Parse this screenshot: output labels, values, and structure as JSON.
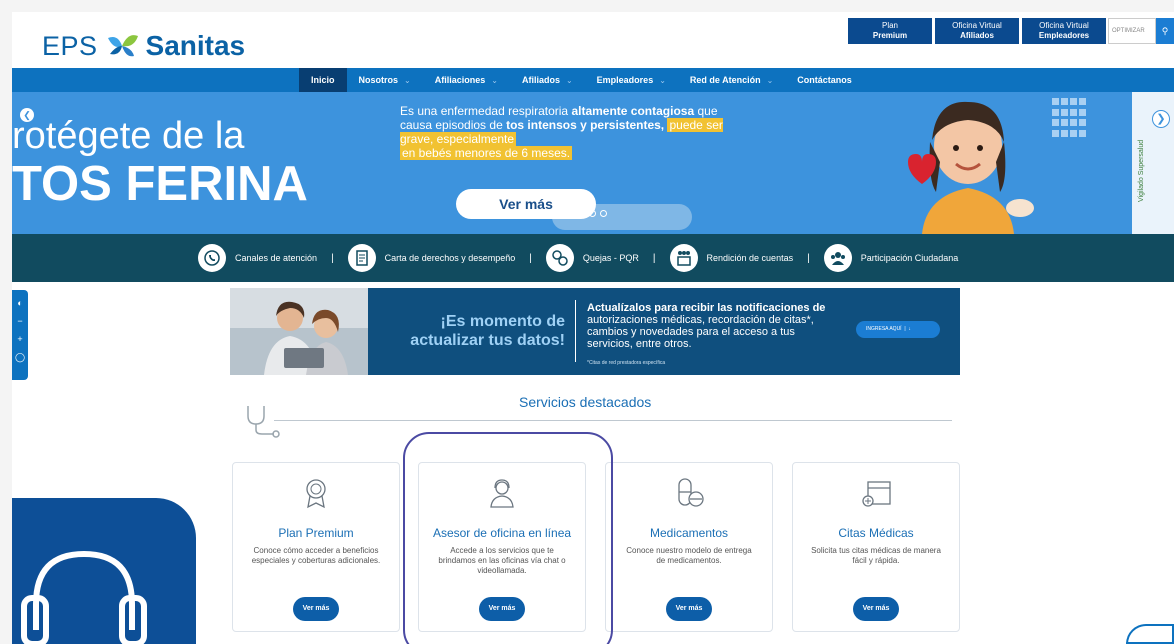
{
  "header": {
    "logo_eps": "EPS",
    "logo_brand": "Sanitas",
    "top_buttons": [
      {
        "line1": "Plan",
        "line2": "Premium"
      },
      {
        "line1": "Oficina Virtual",
        "line2": "Afiliados"
      },
      {
        "line1": "Oficina Virtual",
        "line2": "Empleadores"
      }
    ],
    "search_placeholder": "OPTIMIZAR",
    "brand_color": "#0b62a5"
  },
  "nav": {
    "items": [
      {
        "label": "Inicio",
        "active": true
      },
      {
        "label": "Nosotros"
      },
      {
        "label": "Afiliaciones"
      },
      {
        "label": "Afiliados"
      },
      {
        "label": "Empleadores"
      },
      {
        "label": "Red de Atención"
      },
      {
        "label": "Contáctanos"
      }
    ]
  },
  "hero": {
    "title_line1": "rotégete de la",
    "title_line2": "TOS FERINA",
    "text_1": "Es una enfermedad respiratoria ",
    "text_2": "altamente contagiosa",
    "text_3": " que causa episodios de ",
    "text_4": "tos intensos y persistentes,",
    "text_5": "puede ser grave, especialmente",
    "text_6": "en bebés menores de 6 meses.",
    "button": "Ver más",
    "side_text": "Vigilado Supersalud"
  },
  "quick_links": [
    {
      "label": "Canales de atención"
    },
    {
      "label": "Carta de derechos y desempeño"
    },
    {
      "label": "Quejas - PQR"
    },
    {
      "label": "Rendición de cuentas"
    },
    {
      "label": "Participación Ciudadana"
    }
  ],
  "banner": {
    "headline_1": "¡Es momento de",
    "headline_2": "actualizar tus datos!",
    "text_bold": "Actualízalos para recibir las notificaciones de",
    "text": "autorizaciones médicas, recordación de citas*, cambios y novedades para el acceso a tus servicios, entre otros.",
    "footnote": "*Citas de red prestadora específica",
    "button": "INGRESA AQUÍ"
  },
  "services": {
    "title": "Servicios destacados",
    "cards": [
      {
        "title": "Plan Premium",
        "desc": "Conoce cómo acceder a beneficios especiales y coberturas adicionales.",
        "button": "Ver más"
      },
      {
        "title": "Asesor de oficina en línea",
        "desc": "Accede a los servicios que te brindamos en las oficinas vía chat o videollamada.",
        "button": "Ver más"
      },
      {
        "title": "Medicamentos",
        "desc": "Conoce nuestro modelo de entrega de medicamentos.",
        "button": "Ver más"
      },
      {
        "title": "Citas Médicas",
        "desc": "Solicita tus citas médicas de manera fácil y rápida.",
        "button": "Ver más"
      }
    ]
  }
}
